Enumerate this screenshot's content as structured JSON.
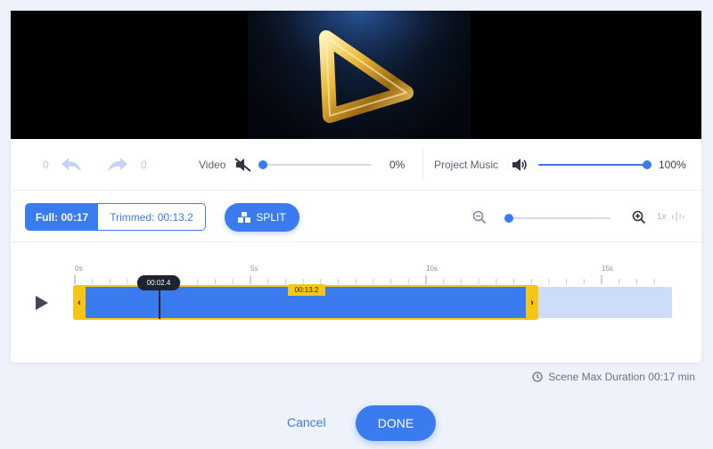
{
  "colors": {
    "accent": "#3a7cf0",
    "trim": "#f5c518",
    "background": "#eef2fb"
  },
  "history": {
    "undo_count": "0",
    "redo_count": "0",
    "undo_icon": "undo-arrow-icon",
    "redo_icon": "redo-arrow-icon"
  },
  "audio": {
    "video_label": "Video",
    "video_volume": 0,
    "video_volume_text": "0%",
    "video_icon": "volume-muted-icon",
    "music_label": "Project Music",
    "music_volume": 100,
    "music_volume_text": "100%",
    "music_icon": "volume-on-icon"
  },
  "trim_toggle": {
    "full_label": "Full: 00:17",
    "trimmed_label": "Trimmed: 00:13.2",
    "selected": "full"
  },
  "split_button": {
    "label": "SPLIT",
    "icon": "split-blocks-icon"
  },
  "zoom": {
    "zoom_out_icon": "zoom-out-icon",
    "zoom_in_icon": "zoom-in-icon",
    "level_text": "1x",
    "level": 0,
    "waveform_icon": "waveform-icon"
  },
  "timeline": {
    "tick_labels": [
      "0s",
      "5s",
      "10s",
      "15s"
    ],
    "playhead_time": "00:02.4",
    "trim_duration": "00:13.2",
    "play_icon": "play-icon"
  },
  "footer": {
    "max_duration": "Scene Max Duration 00:17 min",
    "clock_icon": "clock-icon",
    "cancel_label": "Cancel",
    "done_label": "DONE"
  }
}
